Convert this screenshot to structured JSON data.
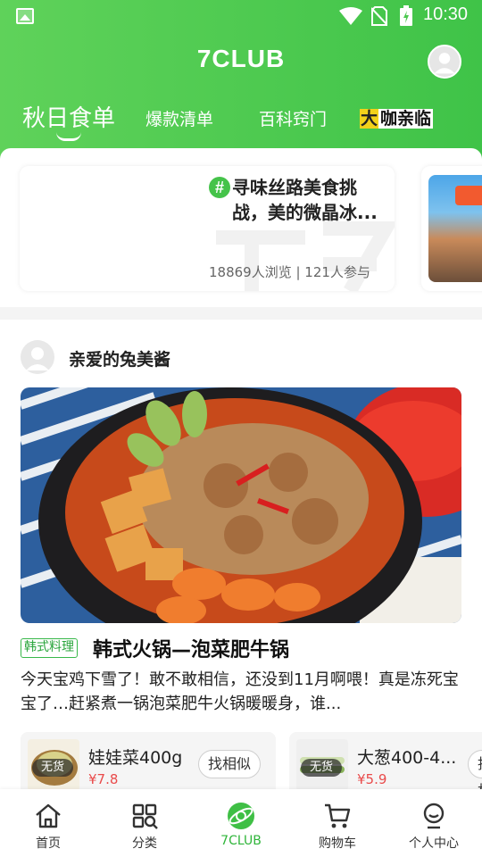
{
  "status_bar": {
    "time": "10:30"
  },
  "header": {
    "title": "7CLUB",
    "tabs": [
      {
        "label": "秋日食单"
      },
      {
        "label": "爆款清单"
      },
      {
        "label": "百科窍门"
      },
      {
        "label_first": "大",
        "label_rest": "咖亲临"
      }
    ]
  },
  "topic": {
    "hash": "#",
    "title": "寻味丝路美食挑战，美的微晶冰...",
    "stats": "18869人浏览 | 121人参与"
  },
  "post": {
    "author": "亲爱的兔美酱",
    "tag": "韩式料理",
    "title": "韩式火锅—泡菜肥牛锅",
    "desc": "今天宝鸡下雪了！敢不敢相信，还没到11月啊喂！真是冻死宝宝了…赶紧煮一锅泡菜肥牛火锅暖暖身，谁..."
  },
  "products": [
    {
      "name": "娃娃菜400g",
      "price": "¥7.8",
      "stock": "无货",
      "action": "找相似"
    },
    {
      "name": "大葱400-4...",
      "price": "¥5.9",
      "stock": "无货",
      "action": "找相似"
    }
  ],
  "nav": [
    {
      "label": "首页",
      "icon": "home-icon"
    },
    {
      "label": "分类",
      "icon": "category-icon"
    },
    {
      "label": "7CLUB",
      "icon": "club-icon"
    },
    {
      "label": "购物车",
      "icon": "cart-icon"
    },
    {
      "label": "个人中心",
      "icon": "profile-icon"
    }
  ],
  "colors": {
    "brand_green": "#45c34a",
    "price_red": "#e94b4b"
  }
}
